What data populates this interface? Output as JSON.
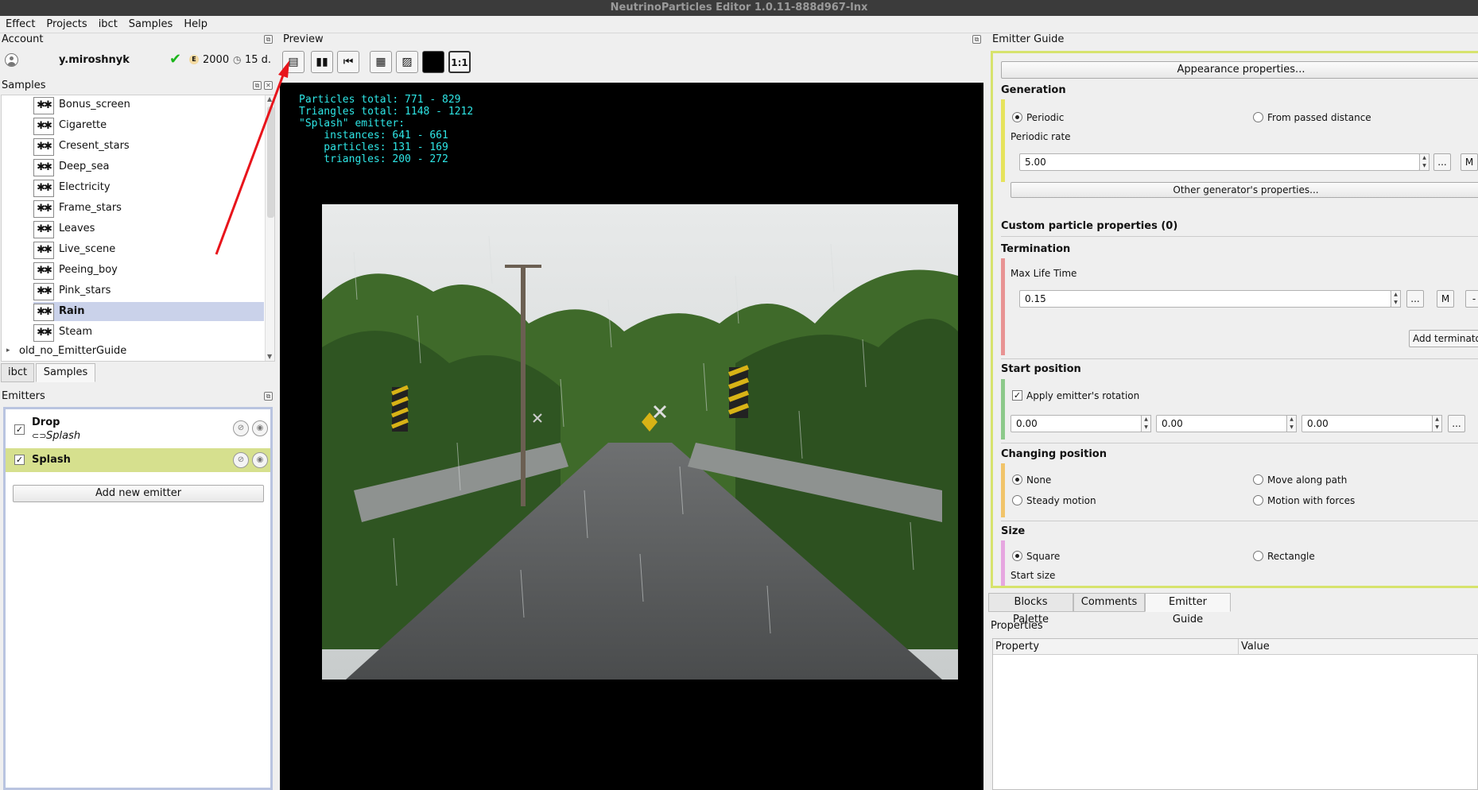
{
  "window": {
    "title": "NeutrinoParticles Editor 1.0.11-888d967-lnx"
  },
  "menu": [
    "Effect",
    "Projects",
    "ibct",
    "Samples",
    "Help"
  ],
  "account": {
    "title": "Account",
    "username": "y.miroshnyk",
    "badge": "E",
    "credits": "2000",
    "days": "15 d."
  },
  "samples": {
    "title": "Samples",
    "items": [
      "Bonus_screen",
      "Cigarette",
      "Cresent_stars",
      "Deep_sea",
      "Electricity",
      "Frame_stars",
      "Leaves",
      "Live_scene",
      "Peeing_boy",
      "Pink_stars",
      "Rain",
      "Steam"
    ],
    "selected": "Rain",
    "folder": "old_no_EmitterGuide",
    "tabs": [
      "ibct",
      "Samples"
    ]
  },
  "emitters": {
    "title": "Emitters",
    "list": [
      {
        "name": "Drop",
        "sub": "Splash"
      },
      {
        "name": "Splash",
        "sub": ""
      }
    ],
    "add_label": "Add new emitter"
  },
  "preview": {
    "title": "Preview",
    "ratio_label": "1:1",
    "stats": {
      "particles_total": "Particles total: 771 - 829",
      "triangles_total": "Triangles total: 1148 - 1212",
      "emitter": "\"Splash\" emitter:",
      "instances": "    instances: 641 - 661",
      "particles": "    particles: 131 - 169",
      "triangles": "    triangles: 200 - 272"
    }
  },
  "guide": {
    "title": "Emitter Guide",
    "appearance_button": "Appearance properties...",
    "generation": {
      "title": "Generation",
      "opt_periodic": "Periodic",
      "opt_distance": "From passed distance",
      "rate_label": "Periodic rate",
      "rate_value": "5.00",
      "other_button": "Other generator's properties..."
    },
    "custom_title": "Custom particle properties (0)",
    "termination": {
      "title": "Termination",
      "label": "Max Life Time",
      "value": "0.15",
      "add_button": "Add terminator"
    },
    "start_position": {
      "title": "Start position",
      "apply_label": "Apply emitter's rotation",
      "x": "0.00",
      "y": "0.00",
      "z": "0.00"
    },
    "changing_position": {
      "title": "Changing position",
      "none": "None",
      "along_path": "Move along path",
      "steady": "Steady motion",
      "forces": "Motion with forces"
    },
    "size": {
      "title": "Size",
      "square": "Square",
      "rectangle": "Rectangle",
      "start_size": "Start size"
    },
    "dots": "...",
    "m": "M",
    "minus": "-"
  },
  "bottom_tabs": [
    "Blocks Palette",
    "Comments",
    "Emitter Guide"
  ],
  "properties": {
    "title": "Properties",
    "col_property": "Property",
    "col_value": "Value"
  },
  "colors": {
    "selection": "#cad2ea",
    "emitter_selected": "#d6e08e",
    "guide_border": "#d7e36d",
    "stats_text": "#2ee6e6",
    "annotation_arrow": "#e8141b"
  }
}
